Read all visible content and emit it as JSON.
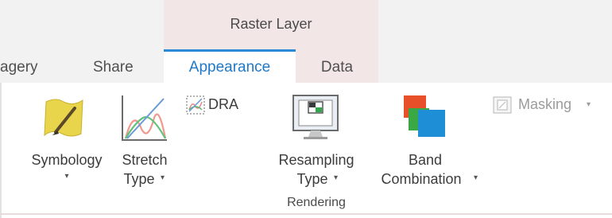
{
  "context_tab": {
    "label": "Raster Layer"
  },
  "tabs": [
    {
      "label": "agery"
    },
    {
      "label": "Share"
    },
    {
      "label": "Appearance",
      "active": true
    },
    {
      "label": "Data"
    }
  ],
  "ribbon": {
    "symbology": {
      "label": "Symbology",
      "caret": "▾"
    },
    "stretch_type": {
      "line1": "Stretch",
      "line2": "Type",
      "caret": "▾"
    },
    "dra": {
      "label": "DRA"
    },
    "resampling_type": {
      "line1": "Resampling",
      "line2": "Type",
      "caret": "▾"
    },
    "band_combination": {
      "line1": "Band",
      "line2": "Combination",
      "caret": "▾"
    },
    "masking": {
      "label": "Masking",
      "caret": "▾",
      "enabled": false
    },
    "group_label": "Rendering"
  },
  "colors": {
    "accent": "#2b8ad8",
    "context_tint": "#f2e7e6",
    "band_red": "#e8502a",
    "band_green": "#3aa845",
    "band_blue": "#1e8fd6",
    "symbology_yellow": "#e9d54b"
  }
}
